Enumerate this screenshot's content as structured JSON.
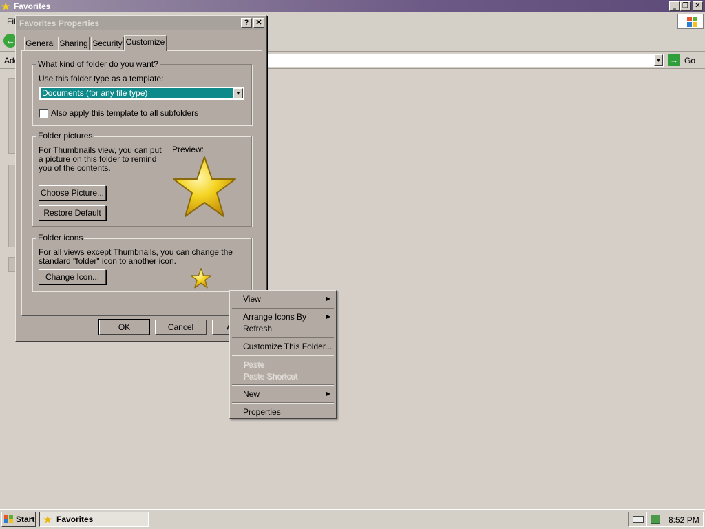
{
  "window": {
    "title": "Favorites",
    "menu_visible": "Fil",
    "address_label": "Add",
    "go_label": "Go"
  },
  "dialog": {
    "title": "Favorites Properties",
    "help_btn": "?",
    "close_btn": "✕",
    "tabs": [
      "General",
      "Sharing",
      "Security",
      "Customize"
    ],
    "active_tab": "Customize",
    "group1": {
      "label": "What kind of folder do you want?",
      "template_label": "Use this folder type as a template:",
      "template_value": "Documents (for any file type)",
      "apply_subfolders": "Also apply this template to all subfolders",
      "apply_checked": false
    },
    "group2": {
      "label": "Folder pictures",
      "description": "For Thumbnails view, you can put a picture on this folder to remind you of the contents.",
      "preview_label": "Preview:",
      "choose_btn": "Choose Picture...",
      "restore_btn": "Restore Default"
    },
    "group3": {
      "label": "Folder icons",
      "description": "For all views except Thumbnails, you can change the standard \"folder\" icon to another icon.",
      "change_btn": "Change Icon..."
    },
    "ok_btn": "OK",
    "cancel_btn": "Cancel",
    "apply_btn": "A"
  },
  "context_menu": {
    "items": [
      {
        "label": "View",
        "submenu": true,
        "disabled": false
      },
      {
        "label": "Arrange Icons By",
        "submenu": true,
        "disabled": false
      },
      {
        "label": "Refresh",
        "submenu": false,
        "disabled": false
      },
      {
        "label": "Customize This Folder...",
        "submenu": false,
        "disabled": false
      },
      {
        "label": "Paste",
        "submenu": false,
        "disabled": true
      },
      {
        "label": "Paste Shortcut",
        "submenu": false,
        "disabled": true
      },
      {
        "label": "New",
        "submenu": true,
        "disabled": false
      },
      {
        "label": "Properties",
        "submenu": false,
        "disabled": false
      }
    ]
  },
  "taskbar": {
    "start_label": "Start",
    "task_label": "Favorites",
    "clock": "8:52 PM"
  },
  "icons": {
    "star": "star-icon",
    "star_color": "#f2d01c",
    "windows_logo": "windows-logo-icon"
  }
}
